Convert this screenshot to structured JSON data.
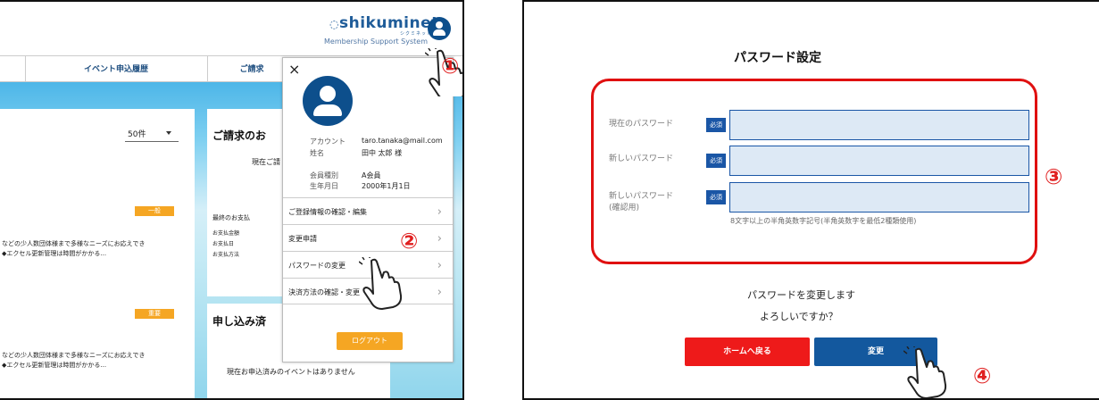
{
  "left": {
    "logo": "shikuminet",
    "logo_sub": "シクミネット",
    "logo_tagline": "Membership Support System",
    "nav_tabs": [
      "イベント申込履歴",
      "ご請求"
    ],
    "per_page": "50件",
    "badge_general": "一般",
    "badge_important": "重要",
    "text_row1a": "などの少人数団体様まで多様なニーズにお応えでき",
    "text_row1b": "◆エクセル更新管理は時間がかかる...",
    "text_row2a": "などの少人数団体様まで多様なニーズにお応えでき",
    "text_row2b": "◆エクセル更新管理は時間がかかる...",
    "card_title_billing": "ご請求のお",
    "card_billing_sub": "現在ご請",
    "last_payment": "最終のお支払",
    "pay_amount": "お支払金額",
    "pay_date": "お支払日",
    "pay_method": "お支払方法",
    "card_title_apply": "申し込み済",
    "no_events": "現在お申込済みのイベントはありません",
    "step1": "①",
    "step2": "②"
  },
  "popup": {
    "close": "×",
    "account_label": "アカウント",
    "account_value": "taro.tanaka@mail.com",
    "name_label": "姓名",
    "name_value": "田中 太郎 様",
    "member_label": "会員種別",
    "member_value": "A会員",
    "birth_label": "生年月日",
    "birth_value": "2000年1月1日",
    "menu": [
      "ご登録情報の確認・編集",
      "変更申請",
      "パスワードの変更",
      "決済方法の確認・変更"
    ],
    "chevron": "›",
    "logout": "ログアウト"
  },
  "right": {
    "title": "パスワード設定",
    "current_password": "現在のパスワード",
    "new_password": "新しいパスワード",
    "new_password_confirm1": "新しいパスワード",
    "new_password_confirm2": "(確認用)",
    "required": "必須",
    "hint": "8文字以上の半角英数字記号(半角英数字を最低2種類使用)",
    "confirm1": "パスワードを変更します",
    "confirm2": "よろしいですか？",
    "home_button": "ホームへ戻る",
    "change_button": "変更",
    "step3": "③",
    "step4": "④"
  },
  "colors": {
    "brand_blue": "#0d4f8c",
    "accent_orange": "#f5a623",
    "alert_red": "#e01010",
    "button_blue": "#13589e"
  }
}
